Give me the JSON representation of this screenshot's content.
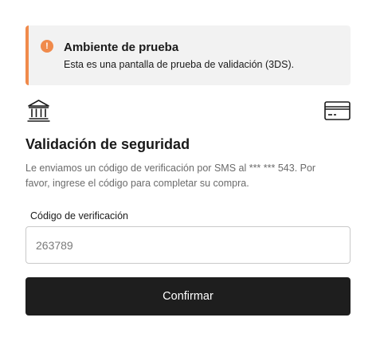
{
  "banner": {
    "icon_symbol": "!",
    "title": "Ambiente de prueba",
    "text": "Esta es una pantalla de prueba de validación (3DS).",
    "accent_color": "#f08a4b",
    "background_color": "#f2f2f2"
  },
  "icons": {
    "bank": "bank-icon",
    "card": "credit-card-icon"
  },
  "main": {
    "title": "Validación de seguridad",
    "description": "Le enviamos un código de verificación por SMS al *** *** 543. Por favor, ingrese el código para completar su compra."
  },
  "form": {
    "code_label": "Código de verificación",
    "code_placeholder": "263789",
    "confirm_label": "Confirmar",
    "button_color": "#1e1e1e"
  }
}
